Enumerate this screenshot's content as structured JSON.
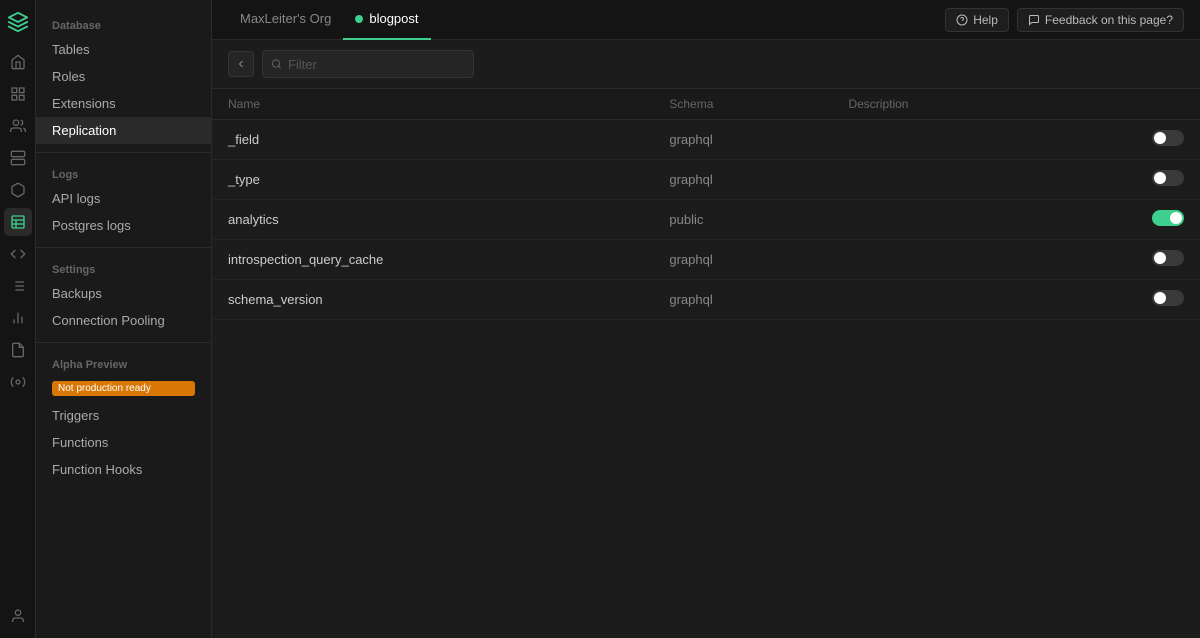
{
  "app": {
    "logo_alt": "Supabase"
  },
  "topbar": {
    "tabs": [
      {
        "id": "org",
        "label": "MaxLeiter's Org",
        "active": false
      },
      {
        "id": "project",
        "label": "blogpost",
        "active": true,
        "dot": true
      }
    ],
    "help_label": "Help",
    "feedback_label": "Feedback on this page?"
  },
  "sidebar": {
    "database_section": "Database",
    "items_main": [
      {
        "id": "tables",
        "label": "Tables",
        "active": false
      },
      {
        "id": "roles",
        "label": "Roles",
        "active": false
      },
      {
        "id": "extensions",
        "label": "Extensions",
        "active": false
      },
      {
        "id": "replication",
        "label": "Replication",
        "active": true
      }
    ],
    "logs_section": "Logs",
    "items_logs": [
      {
        "id": "api-logs",
        "label": "API logs",
        "active": false
      },
      {
        "id": "postgres-logs",
        "label": "Postgres logs",
        "active": false
      }
    ],
    "settings_section": "Settings",
    "items_settings": [
      {
        "id": "backups",
        "label": "Backups",
        "active": false
      },
      {
        "id": "connection-pooling",
        "label": "Connection Pooling",
        "active": false
      }
    ],
    "alpha_section": "Alpha Preview",
    "alpha_badge": "Not production ready",
    "items_alpha": [
      {
        "id": "triggers",
        "label": "Triggers",
        "active": false
      },
      {
        "id": "functions",
        "label": "Functions",
        "active": false
      },
      {
        "id": "function-hooks",
        "label": "Function Hooks",
        "active": false
      }
    ]
  },
  "content": {
    "filter_placeholder": "Filter",
    "table": {
      "columns": [
        {
          "id": "name",
          "label": "Name"
        },
        {
          "id": "schema",
          "label": "Schema"
        },
        {
          "id": "description",
          "label": "Description"
        },
        {
          "id": "toggle",
          "label": ""
        }
      ],
      "rows": [
        {
          "name": "_field",
          "schema": "graphql",
          "description": "",
          "enabled": false
        },
        {
          "name": "_type",
          "schema": "graphql",
          "description": "",
          "enabled": false
        },
        {
          "name": "analytics",
          "schema": "public",
          "description": "",
          "enabled": true
        },
        {
          "name": "introspection_query_cache",
          "schema": "graphql",
          "description": "",
          "enabled": false
        },
        {
          "name": "schema_version",
          "schema": "graphql",
          "description": "",
          "enabled": false
        }
      ]
    }
  },
  "rail_icons": {
    "home": "⌂",
    "grid": "⊞",
    "users": "👤",
    "storage": "🗄",
    "box": "📦",
    "table": "▦",
    "code": "⟨/⟩",
    "list": "≡",
    "chart": "📊",
    "docs": "📄",
    "settings": "⚙",
    "user_bottom": "👤"
  }
}
